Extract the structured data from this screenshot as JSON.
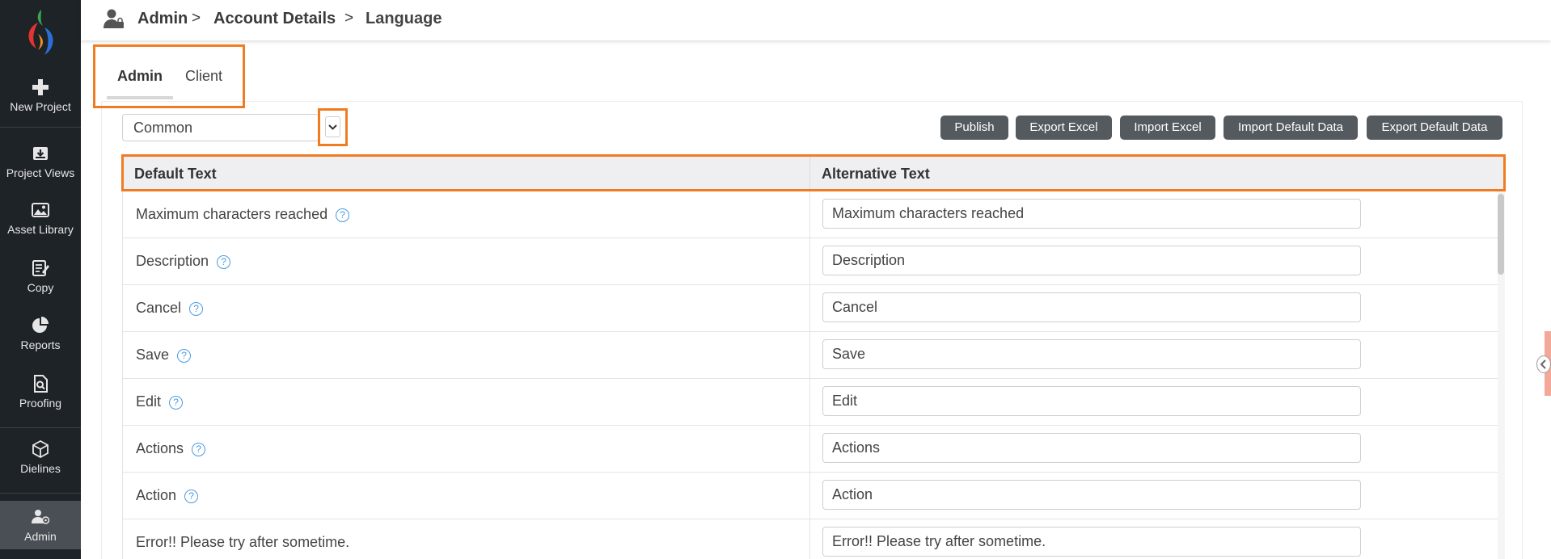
{
  "sidebar": {
    "items": [
      {
        "label": "New Project",
        "icon": "plus-icon"
      },
      {
        "label": "Project Views",
        "icon": "inbox-icon"
      },
      {
        "label": "Asset Library",
        "icon": "image-icon"
      },
      {
        "label": "Copy",
        "icon": "edit-document-icon"
      },
      {
        "label": "Reports",
        "icon": "pie-chart-icon"
      },
      {
        "label": "Proofing",
        "icon": "proof-search-icon"
      },
      {
        "label": "Dielines",
        "icon": "box-icon"
      },
      {
        "label": "Admin",
        "icon": "admin-user-icon",
        "active": true
      }
    ]
  },
  "header": {
    "breadcrumb": [
      "Admin",
      "Account Details",
      "Language"
    ],
    "separator": ">"
  },
  "tabs": [
    {
      "label": "Admin",
      "active": true
    },
    {
      "label": "Client",
      "active": false
    }
  ],
  "toolbar": {
    "select_value": "Common",
    "buttons": [
      "Publish",
      "Export Excel",
      "Import Excel",
      "Import Default Data",
      "Export Default Data"
    ]
  },
  "table": {
    "headers": [
      "Default Text",
      "Alternative Text"
    ],
    "rows": [
      {
        "default": "Maximum characters reached",
        "alternative": "Maximum characters reached",
        "help": true
      },
      {
        "default": "Description",
        "alternative": "Description",
        "help": true
      },
      {
        "default": "Cancel",
        "alternative": "Cancel",
        "help": true
      },
      {
        "default": "Save",
        "alternative": "Save",
        "help": true
      },
      {
        "default": "Edit",
        "alternative": "Edit",
        "help": true
      },
      {
        "default": "Actions",
        "alternative": "Actions",
        "help": true
      },
      {
        "default": "Action",
        "alternative": "Action",
        "help": true
      },
      {
        "default": "Error!! Please try after sometime.",
        "alternative": "Error!! Please try after sometime.",
        "help": false
      }
    ]
  },
  "colors": {
    "sidebar_bg": "#1e2328",
    "highlight": "#f07c22",
    "button_bg": "#555a5f",
    "help_icon": "#4a9be3"
  }
}
